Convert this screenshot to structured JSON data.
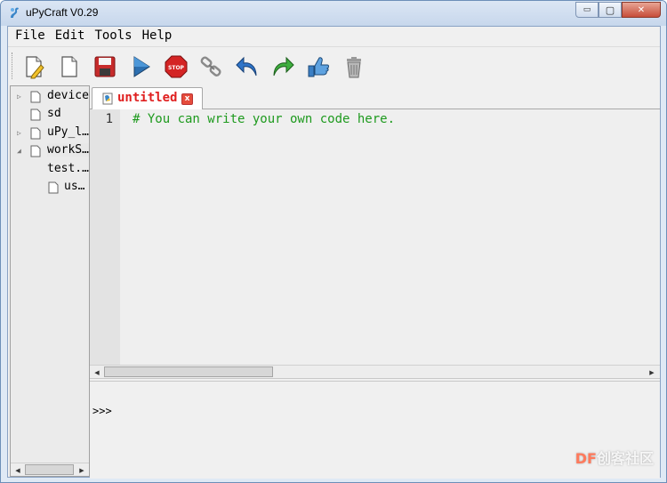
{
  "window": {
    "title": "uPyCraft V0.29",
    "controls": {
      "minimize": "▭",
      "maximize": "▢",
      "close": "✕"
    }
  },
  "menubar": {
    "items": [
      {
        "label": "File"
      },
      {
        "label": "Edit"
      },
      {
        "label": "Tools"
      },
      {
        "label": "Help"
      }
    ]
  },
  "toolbar": {
    "buttons": [
      {
        "name": "new-file-icon"
      },
      {
        "name": "open-file-icon"
      },
      {
        "name": "save-icon"
      },
      {
        "name": "run-icon"
      },
      {
        "name": "stop-icon",
        "label": "STOP"
      },
      {
        "name": "connect-icon"
      },
      {
        "name": "undo-icon"
      },
      {
        "name": "redo-icon"
      },
      {
        "name": "syntax-check-icon"
      },
      {
        "name": "clear-icon"
      }
    ]
  },
  "file_tree": {
    "items": [
      {
        "label": "device",
        "expandable": true,
        "expanded": false
      },
      {
        "label": "sd",
        "expandable": false
      },
      {
        "label": "uPy_l…",
        "expandable": true,
        "expanded": false
      },
      {
        "label": "workS…",
        "expandable": true,
        "expanded": true
      },
      {
        "label": "test.…"
      },
      {
        "label": "us…"
      }
    ]
  },
  "editor": {
    "tab": {
      "label": "untitled",
      "close": "x"
    },
    "lines": [
      {
        "number": "1",
        "code": "# You can write your own code here."
      }
    ]
  },
  "terminal": {
    "prompt": ">>>"
  },
  "watermark": {
    "brand": "DF",
    "text": "创客社区"
  },
  "colors": {
    "tab_label": "#e02020",
    "comment": "#1e9a1e",
    "titlebar": "#c7d7ec"
  }
}
